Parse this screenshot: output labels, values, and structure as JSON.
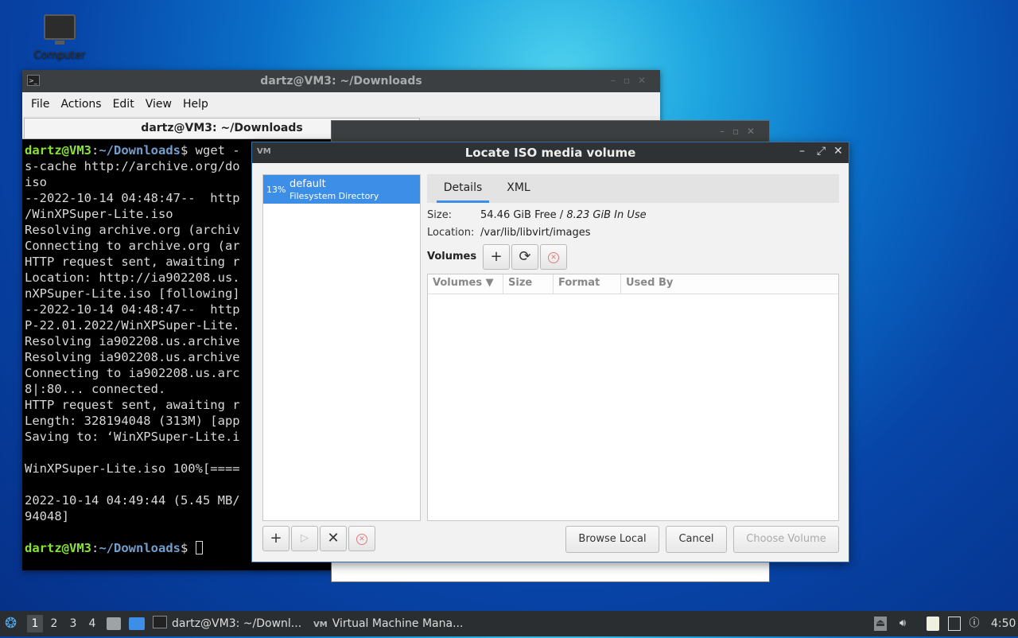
{
  "desktop": {
    "icon_label": "Computer"
  },
  "terminal": {
    "title": "dartz@VM3: ~/Downloads",
    "menu": [
      "File",
      "Actions",
      "Edit",
      "View",
      "Help"
    ],
    "tab_title": "dartz@VM3: ~/Downloads",
    "prompt_user": "dartz@VM3",
    "prompt_sep": ":",
    "prompt_path": "~/Downloads",
    "prompt_end": "$ ",
    "first_cmd": "wget -",
    "lines": [
      "s-cache http://archive.org/do",
      "iso",
      "--2022-10-14 04:48:47--  http",
      "/WinXPSuper-Lite.iso",
      "Resolving archive.org (archiv",
      "Connecting to archive.org (ar",
      "HTTP request sent, awaiting r",
      "Location: http://ia902208.us.",
      "nXPSuper-Lite.iso [following]",
      "--2022-10-14 04:48:47--  http",
      "P-22.01.2022/WinXPSuper-Lite.",
      "Resolving ia902208.us.archive",
      "Resolving ia902208.us.archive",
      "Connecting to ia902208.us.arc",
      "8|:80... connected.",
      "HTTP request sent, awaiting r",
      "Length: 328194048 (313M) [app",
      "Saving to: ‘WinXPSuper-Lite.i",
      "",
      "WinXPSuper-Lite.iso 100%[====",
      "",
      "2022-10-14 04:49:44 (5.45 MB/",
      "94048]",
      ""
    ]
  },
  "dialog": {
    "title": "Locate ISO media volume",
    "pool": {
      "percent": "13%",
      "name": "default",
      "type": "Filesystem Directory"
    },
    "tabs": [
      "Details",
      "XML"
    ],
    "size_label": "Size:",
    "size_free": "54.46 GiB Free",
    "size_sep": " / ",
    "size_inuse": "8.23 GiB In Use",
    "location_label": "Location:",
    "location_value": "/var/lib/libvirt/images",
    "volumes_label": "Volumes",
    "columns": [
      "Volumes",
      "Size",
      "Format",
      "Used By"
    ],
    "sort_icon": "▼",
    "buttons": {
      "browse": "Browse Local",
      "cancel": "Cancel",
      "choose": "Choose Volume"
    }
  },
  "taskbar": {
    "workspaces": [
      "1",
      "2",
      "3",
      "4"
    ],
    "tasks": [
      "dartz@VM3: ~/Downl...",
      "Virtual Machine Mana..."
    ],
    "clock": "4:50"
  }
}
